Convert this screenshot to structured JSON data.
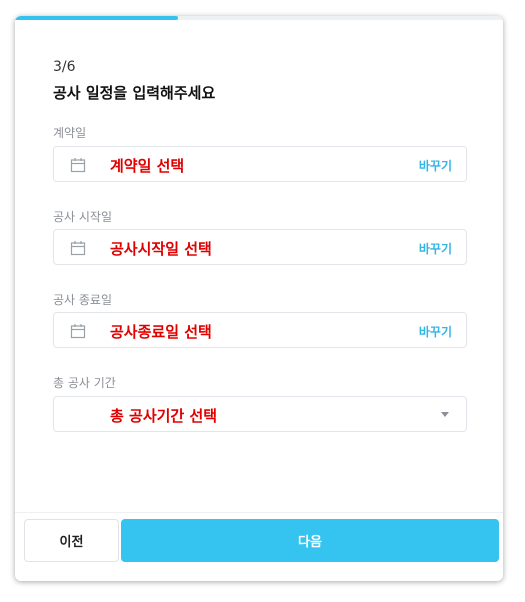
{
  "progress": {
    "current": 3,
    "total": 6,
    "fraction": 0.333
  },
  "header": {
    "step": "3/6",
    "title": "공사 일정을 입력해주세요"
  },
  "fields": {
    "contract": {
      "label": "계약일",
      "value": "계약일 선택",
      "action": "바꾸기",
      "icon": "calendar-icon"
    },
    "start": {
      "label": "공사 시작일",
      "value": "공사시작일 선택",
      "action": "바꾸기",
      "icon": "calendar-icon"
    },
    "end": {
      "label": "공사 종료일",
      "value": "공사종료일 선택",
      "action": "바꾸기",
      "icon": "calendar-icon"
    },
    "duration": {
      "label": "총 공사 기간",
      "value": "총 공사기간 선택",
      "icon": "chevron-down-icon"
    }
  },
  "footer": {
    "prev_label": "이전",
    "next_label": "다음"
  },
  "colors": {
    "accent": "#35c3ef",
    "highlight_text": "#e00000",
    "link": "#33b5e5"
  }
}
